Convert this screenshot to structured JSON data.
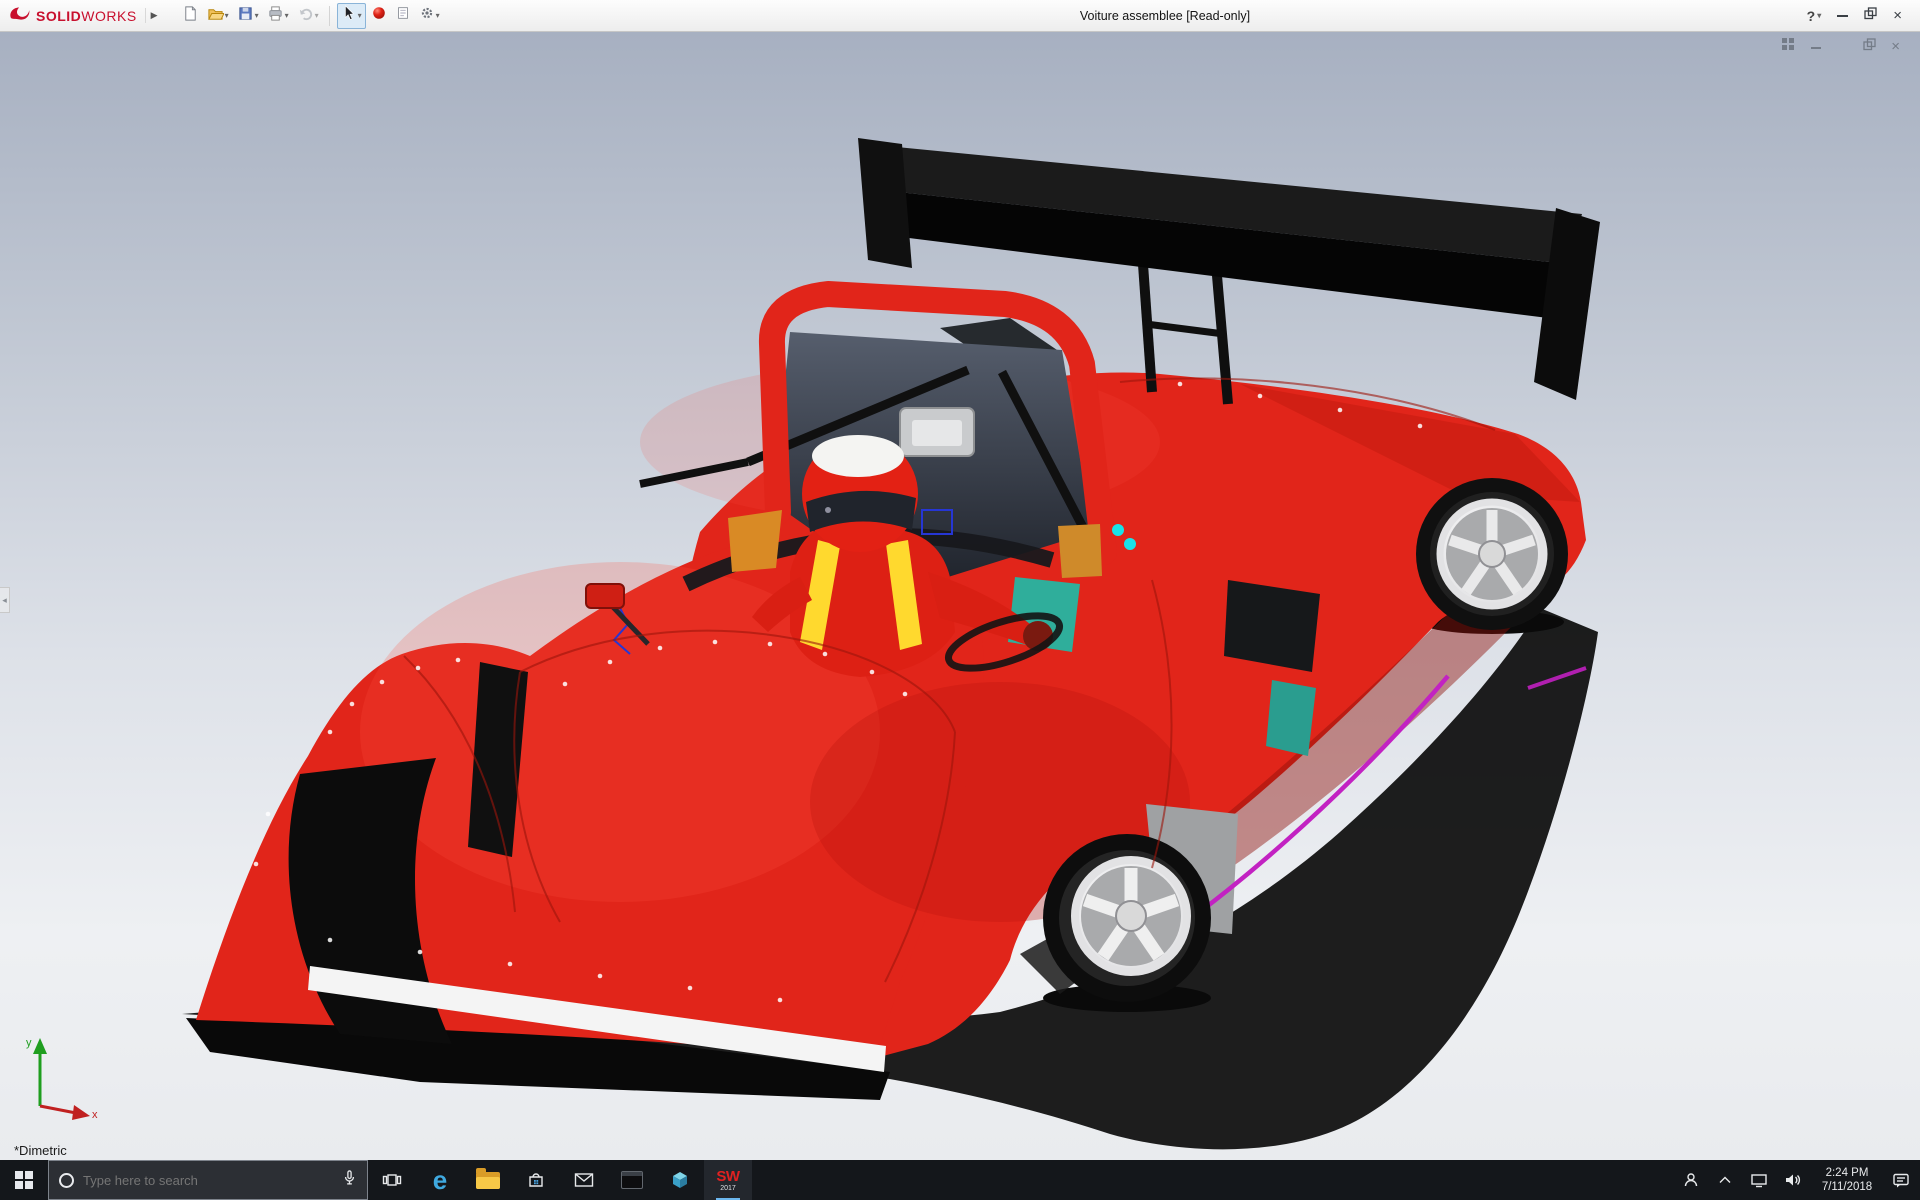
{
  "window": {
    "title": "Voiture assemblee [Read-only]"
  },
  "brand": {
    "name_bold": "SOLID",
    "name_light": "WORKS"
  },
  "glyphs": {
    "caret_down": "▾",
    "flyout": "▶",
    "collapse_left": "◂",
    "help": "?",
    "minimize": "–",
    "close": "×"
  },
  "toolbar_icons": {
    "new-document-icon": "white page with folded corner",
    "open-icon": "yellow folder",
    "save-icon": "blue floppy disk",
    "print-icon": "printer",
    "undo-icon": "gray curved arrow (disabled)",
    "select-arrow-icon": "black cursor arrow (active tool)",
    "appearance-ball-icon": "red glossy sphere",
    "sheet-icon": "white sheet with lines",
    "options-gear-icon": "gray gear"
  },
  "viewport": {
    "view_label": "*Dimetric",
    "axis_x": "x",
    "axis_y": "y"
  },
  "taskbar": {
    "search_placeholder": "Type here to search",
    "edge_glyph": "e",
    "sw_top": "SW",
    "sw_year": "2017",
    "clock": {
      "time": "2:24 PM",
      "date": "7/11/2018"
    }
  },
  "colors": {
    "car_red": "#e1251a",
    "car_red_dark": "#a81208",
    "wing_black": "#161616",
    "wheel_silver": "#e9e9ea",
    "harness_yellow": "#ffd92e",
    "seat_teal": "#2fae9b",
    "trim_magenta": "#c222c2",
    "taskbar_bg": "#14171b",
    "brand_red": "#c8102e"
  }
}
